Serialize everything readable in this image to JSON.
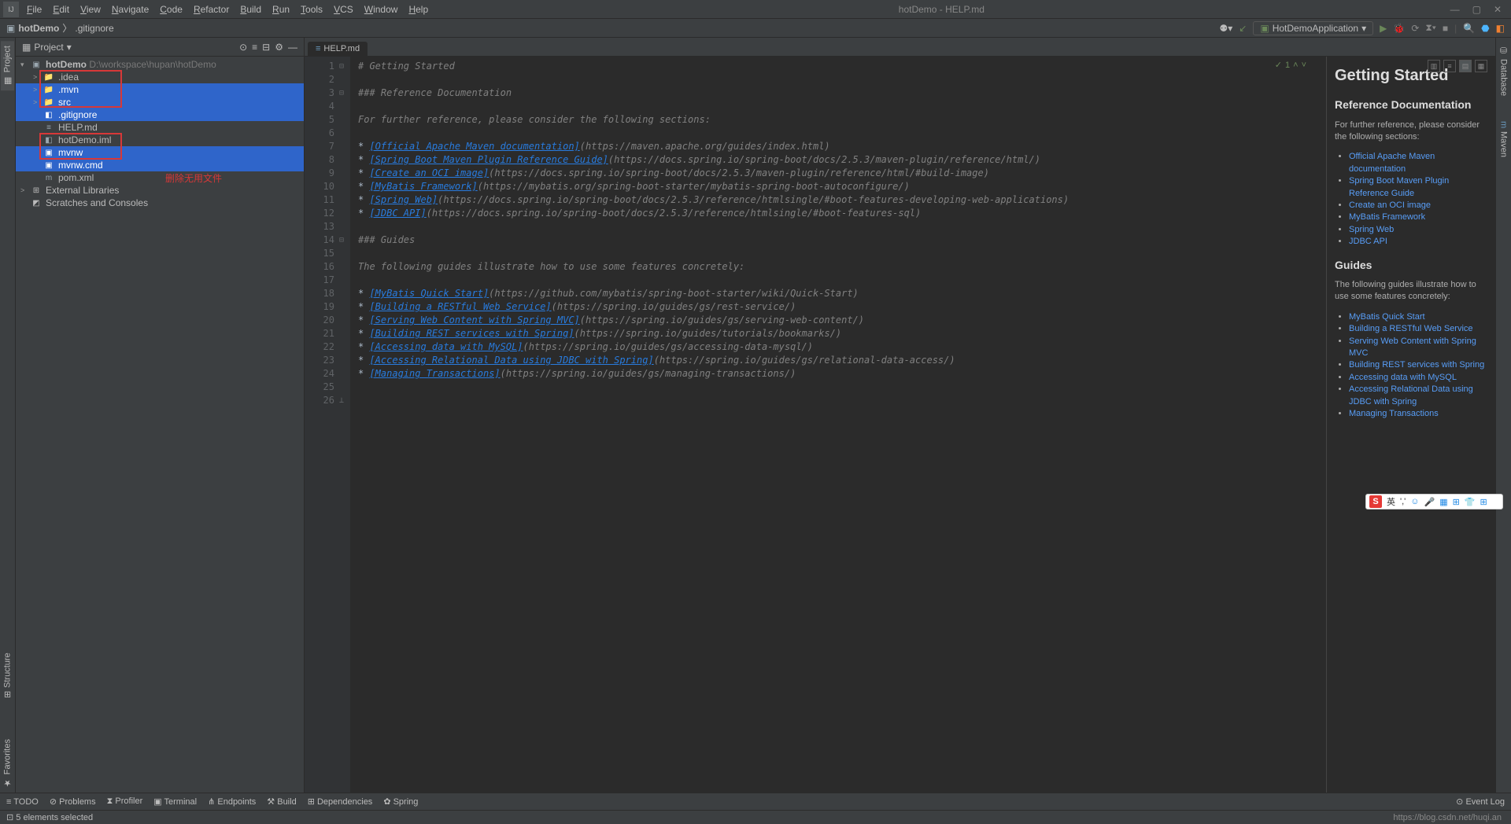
{
  "title_center": "hotDemo - HELP.md",
  "menus": [
    "File",
    "Edit",
    "View",
    "Navigate",
    "Code",
    "Refactor",
    "Build",
    "Run",
    "Tools",
    "VCS",
    "Window",
    "Help"
  ],
  "breadcrumb": [
    "hotDemo",
    ".gitignore"
  ],
  "run_config": "HotDemoApplication",
  "project_tool_label": "Project",
  "left_tabs": [
    "Project",
    "Structure",
    "Favorites"
  ],
  "right_tabs": [
    "Database",
    "Maven"
  ],
  "tree_root": {
    "name": "hotDemo",
    "path": "D:\\workspace\\hupan\\hotDemo"
  },
  "tree_items": [
    {
      "depth": 1,
      "exp": ">",
      "ico": "📁",
      "name": ".idea",
      "sel": false
    },
    {
      "depth": 1,
      "exp": ">",
      "ico": "📁",
      "name": ".mvn",
      "sel": true
    },
    {
      "depth": 1,
      "exp": ">",
      "ico": "📁",
      "name": "src",
      "sel": true
    },
    {
      "depth": 1,
      "exp": "",
      "ico": "◧",
      "name": ".gitignore",
      "sel": true
    },
    {
      "depth": 1,
      "exp": "",
      "ico": "≡",
      "name": "HELP.md",
      "sel": false
    },
    {
      "depth": 1,
      "exp": "",
      "ico": "◧",
      "name": "hotDemo.iml",
      "sel": false
    },
    {
      "depth": 1,
      "exp": "",
      "ico": "▣",
      "name": "mvnw",
      "sel": true
    },
    {
      "depth": 1,
      "exp": "",
      "ico": "▣",
      "name": "mvnw.cmd",
      "sel": true
    },
    {
      "depth": 1,
      "exp": "",
      "ico": "m",
      "name": "pom.xml",
      "sel": false
    }
  ],
  "tree_ext": [
    {
      "depth": 0,
      "exp": ">",
      "ico": "⊞",
      "name": "External Libraries",
      "sel": false
    },
    {
      "depth": 0,
      "exp": "",
      "ico": "◩",
      "name": "Scratches and Consoles",
      "sel": false
    }
  ],
  "annotation_text": "删除无用文件",
  "editor_tab": "HELP.md",
  "code_lines": [
    {
      "n": 1,
      "fold": "⊟",
      "segs": [
        {
          "cls": "c-head",
          "t": "# Getting Started"
        }
      ]
    },
    {
      "n": 2,
      "fold": "",
      "segs": [
        {
          "cls": "",
          "t": ""
        }
      ]
    },
    {
      "n": 3,
      "fold": "⊟",
      "segs": [
        {
          "cls": "c-head",
          "t": "### Reference Documentation"
        }
      ]
    },
    {
      "n": 4,
      "fold": "",
      "segs": [
        {
          "cls": "",
          "t": ""
        }
      ]
    },
    {
      "n": 5,
      "fold": "",
      "segs": [
        {
          "cls": "c-comment",
          "t": "For further reference, please consider the following sections:"
        }
      ]
    },
    {
      "n": 6,
      "fold": "",
      "segs": [
        {
          "cls": "",
          "t": ""
        }
      ]
    },
    {
      "n": 7,
      "fold": "",
      "segs": [
        {
          "cls": "c-bullet",
          "t": "* "
        },
        {
          "cls": "c-link",
          "t": "[Official Apache Maven documentation]"
        },
        {
          "cls": "c-url",
          "t": "(https://maven.apache.org/guides/index.html)"
        }
      ]
    },
    {
      "n": 8,
      "fold": "",
      "segs": [
        {
          "cls": "c-bullet",
          "t": "* "
        },
        {
          "cls": "c-link",
          "t": "[Spring Boot Maven Plugin Reference Guide]"
        },
        {
          "cls": "c-url",
          "t": "(https://docs.spring.io/spring-boot/docs/2.5.3/maven-plugin/reference/html/)"
        }
      ]
    },
    {
      "n": 9,
      "fold": "",
      "segs": [
        {
          "cls": "c-bullet",
          "t": "* "
        },
        {
          "cls": "c-link",
          "t": "[Create an OCI image]"
        },
        {
          "cls": "c-url",
          "t": "(https://docs.spring.io/spring-boot/docs/2.5.3/maven-plugin/reference/html/#build-image)"
        }
      ]
    },
    {
      "n": 10,
      "fold": "",
      "segs": [
        {
          "cls": "c-bullet",
          "t": "* "
        },
        {
          "cls": "c-link",
          "t": "[MyBatis Framework]"
        },
        {
          "cls": "c-url",
          "t": "(https://mybatis.org/spring-boot-starter/mybatis-spring-boot-autoconfigure/)"
        }
      ]
    },
    {
      "n": 11,
      "fold": "",
      "segs": [
        {
          "cls": "c-bullet",
          "t": "* "
        },
        {
          "cls": "c-link",
          "t": "[Spring Web]"
        },
        {
          "cls": "c-url",
          "t": "(https://docs.spring.io/spring-boot/docs/2.5.3/reference/htmlsingle/#boot-features-developing-web-applications)"
        }
      ]
    },
    {
      "n": 12,
      "fold": "",
      "segs": [
        {
          "cls": "c-bullet",
          "t": "* "
        },
        {
          "cls": "c-link",
          "t": "[JDBC API]"
        },
        {
          "cls": "c-url",
          "t": "(https://docs.spring.io/spring-boot/docs/2.5.3/reference/htmlsingle/#boot-features-sql)"
        }
      ]
    },
    {
      "n": 13,
      "fold": "",
      "segs": [
        {
          "cls": "",
          "t": ""
        }
      ]
    },
    {
      "n": 14,
      "fold": "⊟",
      "segs": [
        {
          "cls": "c-head",
          "t": "### Guides"
        }
      ]
    },
    {
      "n": 15,
      "fold": "",
      "segs": [
        {
          "cls": "",
          "t": ""
        }
      ]
    },
    {
      "n": 16,
      "fold": "",
      "segs": [
        {
          "cls": "c-comment",
          "t": "The following guides illustrate how to use some features concretely:"
        }
      ]
    },
    {
      "n": 17,
      "fold": "",
      "segs": [
        {
          "cls": "",
          "t": ""
        }
      ]
    },
    {
      "n": 18,
      "fold": "",
      "segs": [
        {
          "cls": "c-bullet",
          "t": "* "
        },
        {
          "cls": "c-link",
          "t": "[MyBatis Quick Start]"
        },
        {
          "cls": "c-url",
          "t": "(https://github.com/mybatis/spring-boot-starter/wiki/Quick-Start)"
        }
      ]
    },
    {
      "n": 19,
      "fold": "",
      "segs": [
        {
          "cls": "c-bullet",
          "t": "* "
        },
        {
          "cls": "c-link",
          "t": "[Building a RESTful Web Service]"
        },
        {
          "cls": "c-url",
          "t": "(https://spring.io/guides/gs/rest-service/)"
        }
      ]
    },
    {
      "n": 20,
      "fold": "",
      "segs": [
        {
          "cls": "c-bullet",
          "t": "* "
        },
        {
          "cls": "c-link",
          "t": "[Serving Web Content with Spring MVC]"
        },
        {
          "cls": "c-url",
          "t": "(https://spring.io/guides/gs/serving-web-content/)"
        }
      ]
    },
    {
      "n": 21,
      "fold": "",
      "segs": [
        {
          "cls": "c-bullet",
          "t": "* "
        },
        {
          "cls": "c-link",
          "t": "[Building REST services with Spring]"
        },
        {
          "cls": "c-url",
          "t": "(https://spring.io/guides/tutorials/bookmarks/)"
        }
      ]
    },
    {
      "n": 22,
      "fold": "",
      "segs": [
        {
          "cls": "c-bullet",
          "t": "* "
        },
        {
          "cls": "c-link",
          "t": "[Accessing data with MySQL]"
        },
        {
          "cls": "c-url",
          "t": "(https://spring.io/guides/gs/accessing-data-mysql/)"
        }
      ]
    },
    {
      "n": 23,
      "fold": "",
      "segs": [
        {
          "cls": "c-bullet",
          "t": "* "
        },
        {
          "cls": "c-link",
          "t": "[Accessing Relational Data using JDBC with Spring]"
        },
        {
          "cls": "c-url",
          "t": "(https://spring.io/guides/gs/relational-data-access/)"
        }
      ]
    },
    {
      "n": 24,
      "fold": "",
      "segs": [
        {
          "cls": "c-bullet",
          "t": "* "
        },
        {
          "cls": "c-link",
          "t": "[Managing Transactions]"
        },
        {
          "cls": "c-url",
          "t": "(https://spring.io/guides/gs/managing-transactions/)"
        }
      ]
    },
    {
      "n": 25,
      "fold": "",
      "segs": [
        {
          "cls": "",
          "t": ""
        }
      ]
    },
    {
      "n": 26,
      "fold": "⊥",
      "segs": [
        {
          "cls": "",
          "t": ""
        }
      ]
    }
  ],
  "code_status": {
    "check": "✓",
    "count": "1",
    "up": "˄",
    "down": "˅"
  },
  "preview": {
    "h1": "Getting Started",
    "ref_h": "Reference Documentation",
    "ref_p": "For further reference, please consider the following sections:",
    "ref_links": [
      "Official Apache Maven documentation",
      "Spring Boot Maven Plugin Reference Guide",
      "Create an OCI image",
      "MyBatis Framework",
      "Spring Web",
      "JDBC API"
    ],
    "guides_h": "Guides",
    "guides_p": "The following guides illustrate how to use some features concretely:",
    "guides_links": [
      "MyBatis Quick Start",
      "Building a RESTful Web Service",
      "Serving Web Content with Spring MVC",
      "Building REST services with Spring",
      "Accessing data with MySQL",
      "Accessing Relational Data using JDBC with Spring",
      "Managing Transactions"
    ]
  },
  "bottom_tools": [
    "TODO",
    "Problems",
    "Profiler",
    "Terminal",
    "Endpoints",
    "Build",
    "Dependencies",
    "Spring"
  ],
  "bottom_icons": [
    "≡",
    "⊘",
    "⧗",
    "▣",
    "⋔",
    "⚒",
    "⊞",
    "✿"
  ],
  "event_log": "Event Log",
  "status_left": "5 elements selected",
  "watermark": "https://blog.csdn.net/huqi.an",
  "ime_items": [
    "英",
    "','",
    "☺",
    "🎤",
    "▦",
    "⊞",
    "👕",
    "⊞"
  ]
}
